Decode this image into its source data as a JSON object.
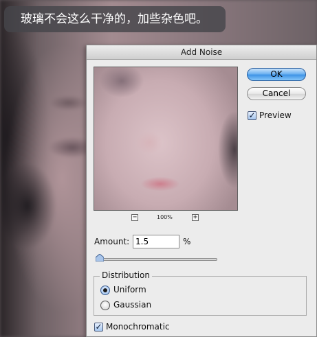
{
  "caption": {
    "text": "玻璃不会这么干净的，加些杂色吧。"
  },
  "dialog": {
    "title": "Add Noise",
    "ok_label": "OK",
    "cancel_label": "Cancel",
    "preview": {
      "label": "Preview",
      "checked": true
    },
    "zoom": {
      "minus": "−",
      "plus": "+",
      "value": "100%"
    },
    "amount": {
      "label": "Amount:",
      "value": "1.5",
      "unit": "%",
      "slider_level": 1.5
    },
    "distribution": {
      "title": "Distribution",
      "options": [
        {
          "label": "Uniform",
          "selected": true
        },
        {
          "label": "Gaussian",
          "selected": false
        }
      ]
    },
    "monochromatic": {
      "label": "Monochromatic",
      "checked": true
    }
  },
  "colors": {
    "ok_button": "#4a9df0",
    "dialog_bg": "#ececec"
  }
}
